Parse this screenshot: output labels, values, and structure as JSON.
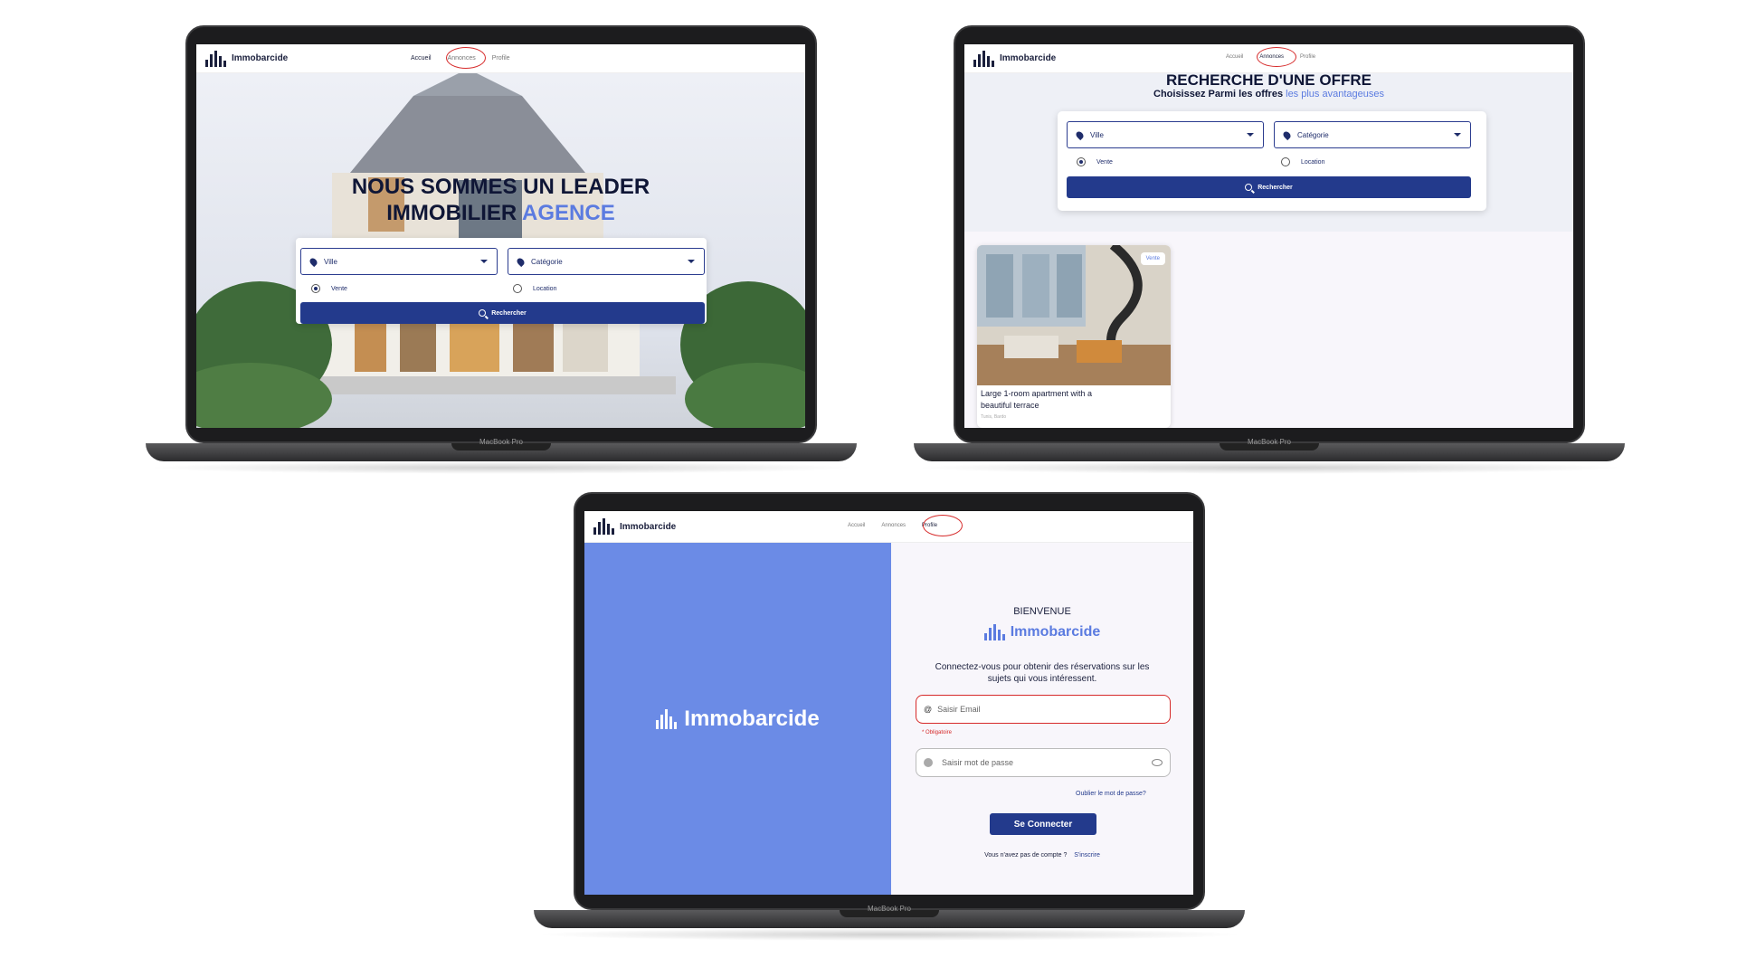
{
  "brand": "Immobarcide",
  "nav": {
    "home": "Accueil",
    "listings": "Annonces",
    "profile": "Profile"
  },
  "device_label": "MacBook Pro",
  "home": {
    "hero_line1": "NOUS SOMMES UN LEADER",
    "hero_line2_a": "IMMOBILIER",
    "hero_line2_b": "AGENCE",
    "city_placeholder": "Ville",
    "category_placeholder": "Catégorie",
    "radio_sale": "Vente",
    "radio_rent": "Location",
    "search_button": "Rechercher"
  },
  "listings": {
    "title": "RECHERCHE D'UNE OFFRE",
    "subtitle_a": "Choisissez Parmi les offres",
    "subtitle_b": "les plus avantageuses",
    "city_placeholder": "Ville",
    "category_placeholder": "Catégorie",
    "radio_sale": "Vente",
    "radio_rent": "Location",
    "search_button": "Rechercher",
    "card": {
      "badge": "Vente",
      "title_line1": "Large 1-room apartment with a",
      "title_line2": "beautiful terrace",
      "location": "Tunis, Bardo"
    }
  },
  "login": {
    "side_brand": "Immobarcide",
    "welcome": "BIENVENUE",
    "brand": "Immobarcide",
    "intro_line1": "Connectez-vous pour obtenir des réservations sur les",
    "intro_line2": "sujets qui vous intéressent.",
    "email_placeholder": "Saisir Email",
    "required": "* Obligatoire",
    "password_placeholder": "Saisir mot de passe",
    "forgot": "Oublier le mot de passe?",
    "submit": "Se Connecter",
    "no_account": "Vous n'avez pas de compte ?",
    "signup": "S'inscrire"
  },
  "colors": {
    "accent": "#233a8c",
    "login_panel": "#6b8be6",
    "highlight_text": "#5b7be0",
    "annotation": "#d62a2a"
  }
}
